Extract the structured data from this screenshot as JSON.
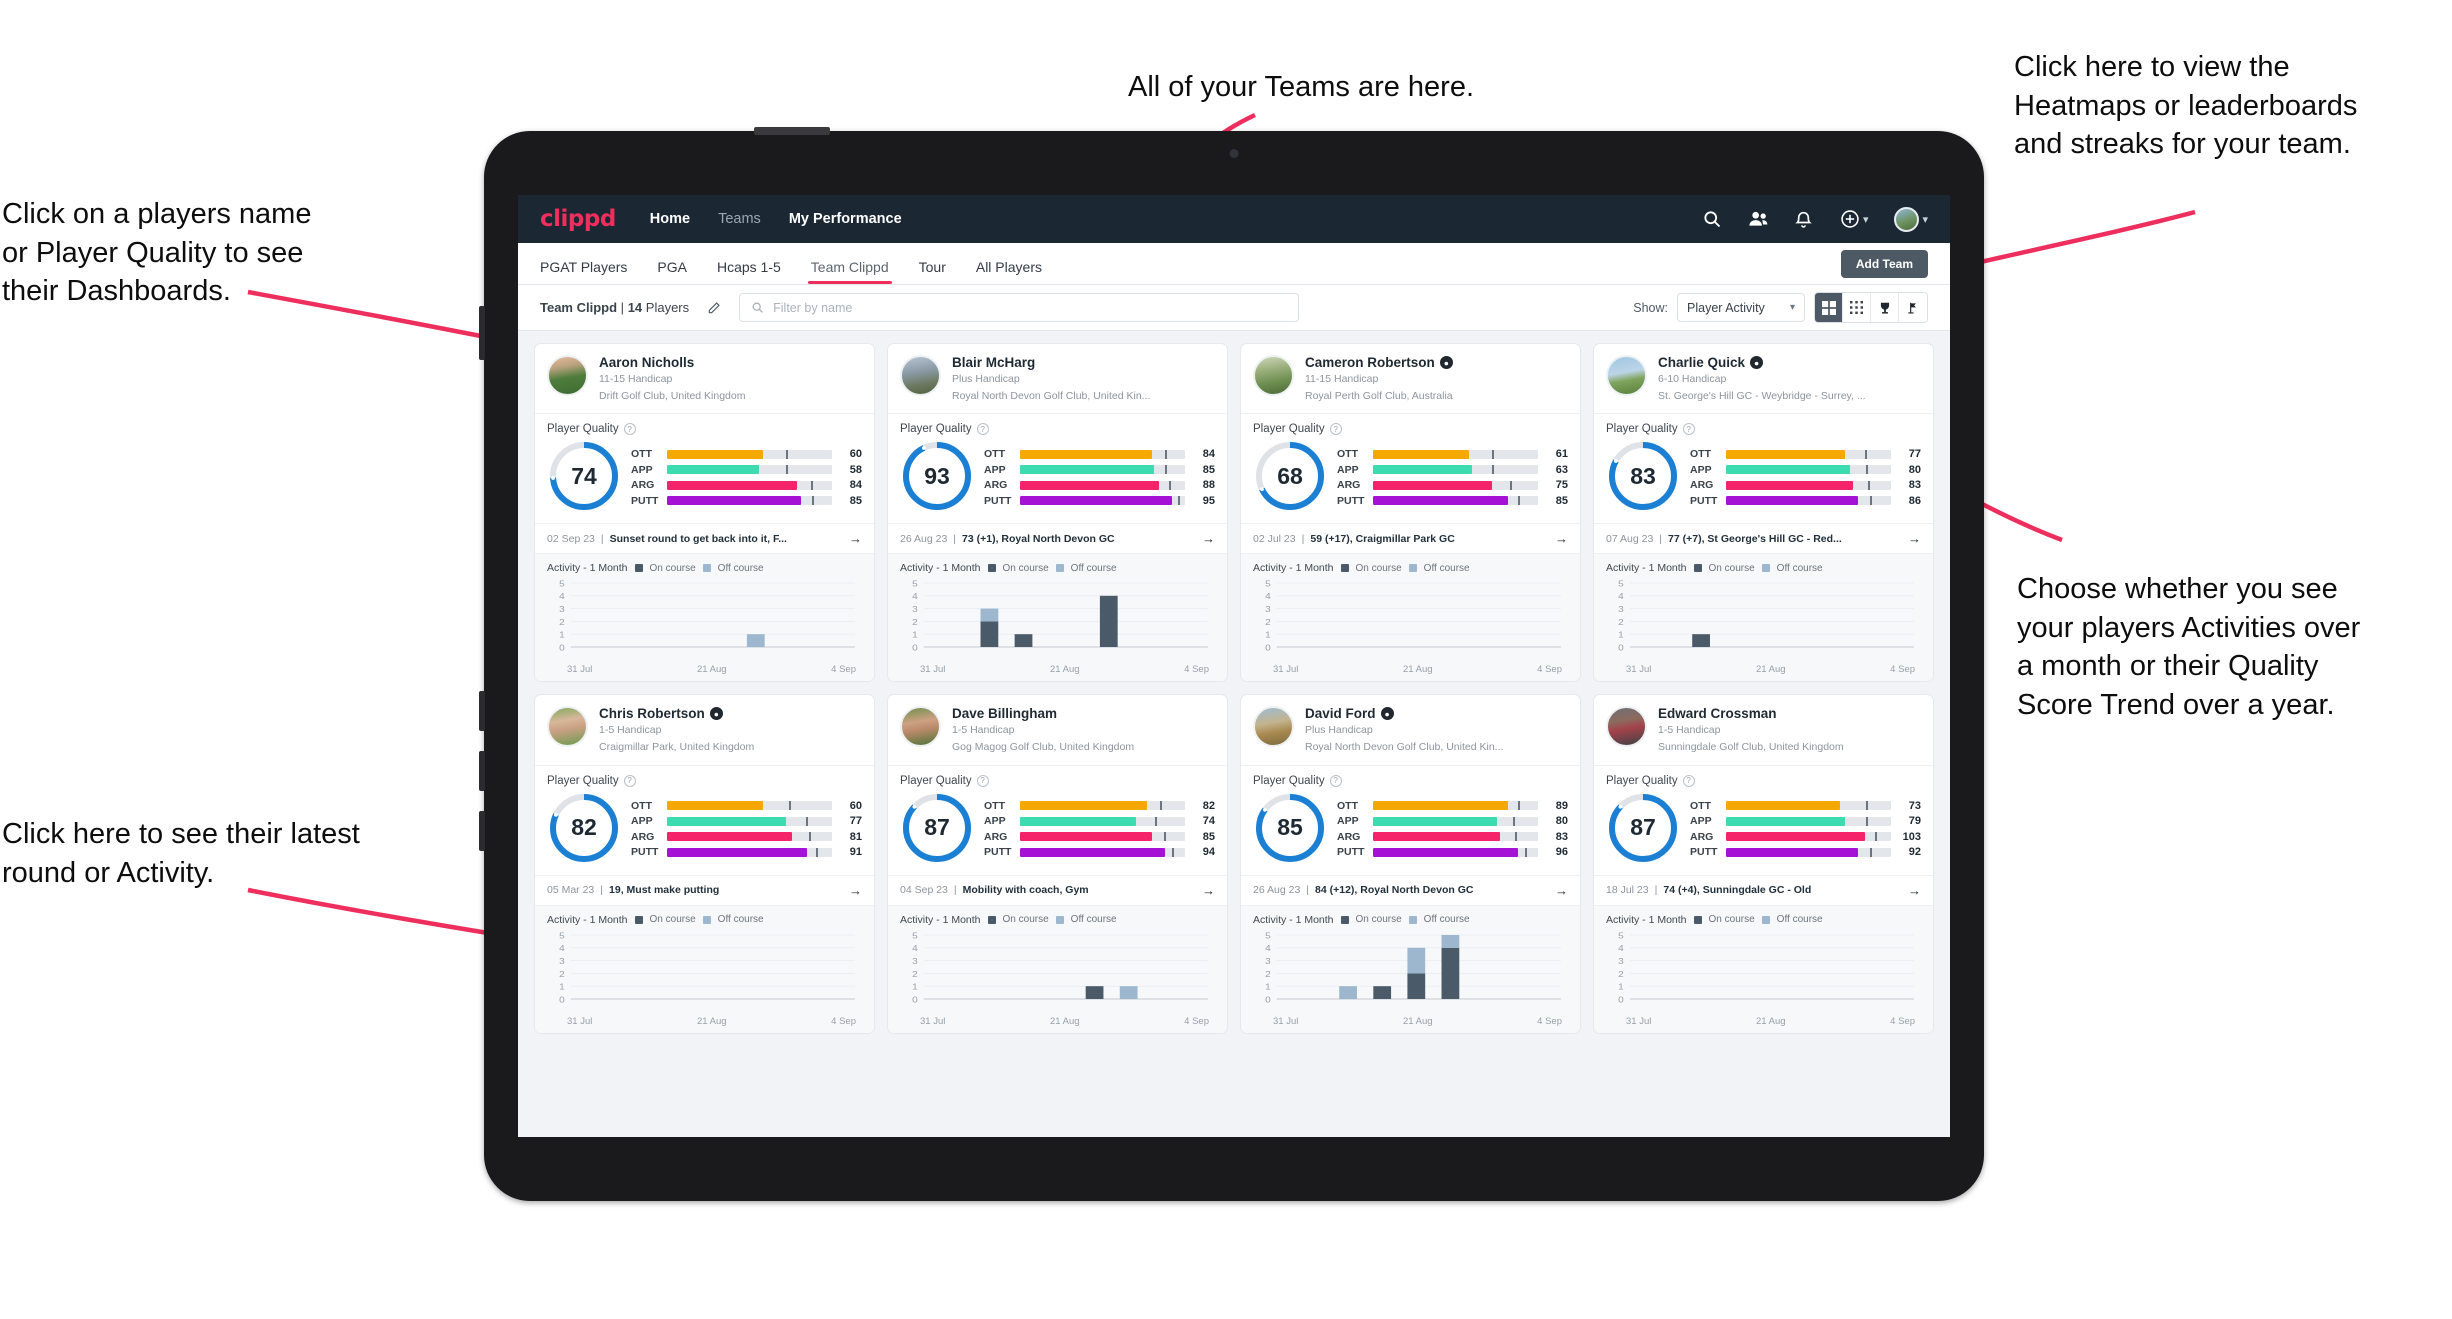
{
  "annotations": [
    {
      "id": "a-teams",
      "text": "All of your Teams are here."
    },
    {
      "id": "a-heatmaps",
      "text": "Click here to view the\nHeatmaps or leaderboards\nand streaks for your team."
    },
    {
      "id": "a-names",
      "text": "Click on a players name\nor Player Quality to see\ntheir Dashboards."
    },
    {
      "id": "a-choose",
      "text": "Choose whether you see\nyour players Activities over\na month or their Quality\nScore Trend over a year."
    },
    {
      "id": "a-latest",
      "text": "Click here to see their latest\nround or Activity."
    }
  ],
  "app": {
    "logo": "clippd",
    "nav": [
      {
        "label": "Home",
        "active": true
      },
      {
        "label": "Teams",
        "active": false
      },
      {
        "label": "My Performance",
        "active": true
      }
    ],
    "header_icons": [
      {
        "name": "search-icon"
      },
      {
        "name": "people-icon"
      },
      {
        "name": "bell-icon"
      },
      {
        "name": "plus-circle-icon"
      },
      {
        "name": "avatar-icon"
      }
    ],
    "tabs": [
      {
        "label": "PGAT Players",
        "active": false
      },
      {
        "label": "PGA",
        "active": false
      },
      {
        "label": "Hcaps 1-5",
        "active": false
      },
      {
        "label": "Team Clippd",
        "active": true
      },
      {
        "label": "Tour",
        "active": false
      },
      {
        "label": "All Players",
        "active": false
      }
    ],
    "add_team_label": "Add Team",
    "filter": {
      "team_name": "Team Clippd",
      "separator": "|",
      "player_count": "14",
      "players_word": "Players",
      "search_placeholder": "Filter by name",
      "show_label": "Show:",
      "show_value": "Player Activity",
      "views": [
        {
          "name": "grid-large-icon",
          "active": true
        },
        {
          "name": "grid-small-icon",
          "active": false
        },
        {
          "name": "trophy-icon",
          "active": false
        },
        {
          "name": "flag-golf-icon",
          "active": false
        }
      ]
    }
  },
  "colors": {
    "brand_pink": "#ee2e5d",
    "navy": "#1b2733",
    "ott": "#f5a800",
    "app": "#3ddbb0",
    "arg": "#f5246a",
    "putt": "#a512d6",
    "ring": "#1b7fd4",
    "on_course": "#4a5a68",
    "off_course": "#9cb7ce"
  },
  "chart_data": {
    "type": "bar",
    "title": "Activity - 1 Month",
    "legend": [
      "On course",
      "Off course"
    ],
    "yticks": [
      0,
      1,
      2,
      3,
      4,
      5
    ],
    "ylim": [
      0,
      5
    ],
    "xticks": [
      "31 Jul",
      "21 Aug",
      "4 Sep"
    ]
  },
  "players": [
    {
      "name": "Aaron Nicholls",
      "verified": false,
      "handicap": "11-15 Handicap",
      "club": "Drift Golf Club, United Kingdom",
      "avatar_css": "linear-gradient(170deg,#e9b9a0 0%,#b9a27e 28%,#4f7d3d 55%,#3e6b31 100%)",
      "quality_label": "Player Quality",
      "quality_score": 74,
      "metrics": [
        {
          "label": "OTT",
          "value": 60,
          "fill": 58,
          "tick": 72
        },
        {
          "label": "APP",
          "value": 58,
          "fill": 56,
          "tick": 72
        },
        {
          "label": "ARG",
          "value": 84,
          "fill": 79,
          "tick": 87
        },
        {
          "label": "PUTT",
          "value": 85,
          "fill": 81,
          "tick": 88
        }
      ],
      "round_date": "02 Sep 23",
      "round_text": "Sunset round to get back into it, F...",
      "activity_label": "Activity - 1 Month",
      "bars": [
        {
          "x": 62,
          "on": 0,
          "off": 1
        }
      ]
    },
    {
      "name": "Blair McHarg",
      "verified": false,
      "handicap": "Plus Handicap",
      "club": "Royal North Devon Golf Club, United Kin...",
      "avatar_css": "linear-gradient(170deg,#b9c6d2 0%,#8a9aa6 40%,#6d7a63 70%,#55613f 100%)",
      "quality_label": "Player Quality",
      "quality_score": 93,
      "metrics": [
        {
          "label": "OTT",
          "value": 84,
          "fill": 80,
          "tick": 88
        },
        {
          "label": "APP",
          "value": 85,
          "fill": 81,
          "tick": 88
        },
        {
          "label": "ARG",
          "value": 88,
          "fill": 84,
          "tick": 90
        },
        {
          "label": "PUTT",
          "value": 95,
          "fill": 92,
          "tick": 96
        }
      ],
      "round_date": "26 Aug 23",
      "round_text": "73 (+1), Royal North Devon GC",
      "activity_label": "Activity - 1 Month",
      "bars": [
        {
          "x": 20,
          "on": 2,
          "off": 1
        },
        {
          "x": 32,
          "on": 1,
          "off": 0
        },
        {
          "x": 62,
          "on": 4,
          "off": 0
        }
      ]
    },
    {
      "name": "Cameron Robertson",
      "verified": true,
      "handicap": "11-15 Handicap",
      "club": "Royal Perth Golf Club, Australia",
      "avatar_css": "linear-gradient(170deg,#cfd8bc 0%,#9aae7c 35%,#6f8f52 65%,#4c6b38 100%)",
      "quality_label": "Player Quality",
      "quality_score": 68,
      "metrics": [
        {
          "label": "OTT",
          "value": 61,
          "fill": 58,
          "tick": 72
        },
        {
          "label": "APP",
          "value": 63,
          "fill": 60,
          "tick": 72
        },
        {
          "label": "ARG",
          "value": 75,
          "fill": 72,
          "tick": 83
        },
        {
          "label": "PUTT",
          "value": 85,
          "fill": 82,
          "tick": 88
        }
      ],
      "round_date": "02 Jul 23",
      "round_text": "59 (+17), Craigmillar Park GC",
      "activity_label": "Activity - 1 Month",
      "bars": []
    },
    {
      "name": "Charlie Quick",
      "verified": true,
      "handicap": "6-10 Handicap",
      "club": "St. George's Hill GC - Weybridge - Surrey, ...",
      "avatar_css": "linear-gradient(170deg,#9fc7e4 0%,#bcd4e6 42%,#7fa35c 62%,#59803f 100%)",
      "quality_label": "Player Quality",
      "quality_score": 83,
      "metrics": [
        {
          "label": "OTT",
          "value": 77,
          "fill": 72,
          "tick": 84
        },
        {
          "label": "APP",
          "value": 80,
          "fill": 75,
          "tick": 85
        },
        {
          "label": "ARG",
          "value": 83,
          "fill": 77,
          "tick": 86
        },
        {
          "label": "PUTT",
          "value": 86,
          "fill": 80,
          "tick": 87
        }
      ],
      "round_date": "07 Aug 23",
      "round_text": "77 (+7), St George's Hill GC - Red...",
      "activity_label": "Activity - 1 Month",
      "bars": [
        {
          "x": 22,
          "on": 1,
          "off": 0
        }
      ]
    },
    {
      "name": "Chris Robertson",
      "verified": true,
      "handicap": "1-5 Handicap",
      "club": "Craigmillar Park, United Kingdom",
      "avatar_css": "linear-gradient(170deg,#7fa85d 0%,#d9b79a 35%,#caa184 55%,#6d9a4f 100%)",
      "quality_label": "Player Quality",
      "quality_score": 82,
      "metrics": [
        {
          "label": "OTT",
          "value": 60,
          "fill": 58,
          "tick": 74
        },
        {
          "label": "APP",
          "value": 77,
          "fill": 72,
          "tick": 84
        },
        {
          "label": "ARG",
          "value": 81,
          "fill": 76,
          "tick": 86
        },
        {
          "label": "PUTT",
          "value": 91,
          "fill": 85,
          "tick": 90
        }
      ],
      "round_date": "05 Mar 23",
      "round_text": "19, Must make putting",
      "activity_label": "Activity - 1 Month",
      "bars": []
    },
    {
      "name": "Dave Billingham",
      "verified": false,
      "handicap": "1-5 Handicap",
      "club": "Gog Magog Golf Club, United Kingdom",
      "avatar_css": "linear-gradient(170deg,#6b8f4c 0%,#cfa183 38%,#b88a6a 58%,#4f7338 100%)",
      "quality_label": "Player Quality",
      "quality_score": 87,
      "metrics": [
        {
          "label": "OTT",
          "value": 82,
          "fill": 77,
          "tick": 85
        },
        {
          "label": "APP",
          "value": 74,
          "fill": 70,
          "tick": 82
        },
        {
          "label": "ARG",
          "value": 85,
          "fill": 80,
          "tick": 87
        },
        {
          "label": "PUTT",
          "value": 94,
          "fill": 88,
          "tick": 92
        }
      ],
      "round_date": "04 Sep 23",
      "round_text": "Mobility with coach, Gym",
      "activity_label": "Activity - 1 Month",
      "bars": [
        {
          "x": 57,
          "on": 1,
          "off": 0
        },
        {
          "x": 69,
          "on": 0,
          "off": 1
        }
      ]
    },
    {
      "name": "David Ford",
      "verified": true,
      "handicap": "Plus Handicap",
      "club": "Royal North Devon Golf Club, United Kin...",
      "avatar_css": "linear-gradient(170deg,#9dbcd4 0%,#c3b48e 40%,#a8894f 65%,#7d6a3e 100%)",
      "quality_label": "Player Quality",
      "quality_score": 85,
      "metrics": [
        {
          "label": "OTT",
          "value": 89,
          "fill": 82,
          "tick": 88
        },
        {
          "label": "APP",
          "value": 80,
          "fill": 75,
          "tick": 85
        },
        {
          "label": "ARG",
          "value": 83,
          "fill": 77,
          "tick": 86
        },
        {
          "label": "PUTT",
          "value": 96,
          "fill": 88,
          "tick": 92
        }
      ],
      "round_date": "26 Aug 23",
      "round_text": "84 (+12), Royal North Devon GC",
      "activity_label": "Activity - 1 Month",
      "bars": [
        {
          "x": 22,
          "on": 0,
          "off": 1
        },
        {
          "x": 34,
          "on": 1,
          "off": 0
        },
        {
          "x": 46,
          "on": 2,
          "off": 2
        },
        {
          "x": 58,
          "on": 4,
          "off": 1
        }
      ]
    },
    {
      "name": "Edward Crossman",
      "verified": false,
      "handicap": "1-5 Handicap",
      "club": "Sunningdale Golf Club, United Kingdom",
      "avatar_css": "linear-gradient(170deg,#6e6f73 0%,#8d6a5e 35%,#a3424a 55%,#3f4246 100%)",
      "quality_label": "Player Quality",
      "quality_score": 87,
      "metrics": [
        {
          "label": "OTT",
          "value": 73,
          "fill": 69,
          "tick": 85
        },
        {
          "label": "APP",
          "value": 79,
          "fill": 72,
          "tick": 85
        },
        {
          "label": "ARG",
          "value": 103,
          "fill": 84,
          "tick": 90
        },
        {
          "label": "PUTT",
          "value": 92,
          "fill": 80,
          "tick": 87
        }
      ],
      "round_date": "18 Jul 23",
      "round_text": "74 (+4), Sunningdale GC - Old",
      "activity_label": "Activity - 1 Month",
      "bars": []
    }
  ]
}
